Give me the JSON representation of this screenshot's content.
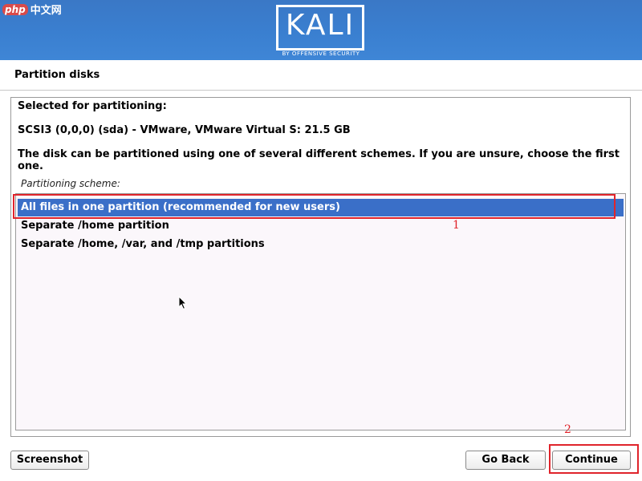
{
  "watermark": {
    "brand": "php",
    "site": "中文网"
  },
  "header": {
    "logo_text": "KALI",
    "logo_sub": "BY OFFENSIVE SECURITY",
    "banner_color": "#3a7fd0"
  },
  "page": {
    "title": "Partition disks"
  },
  "content": {
    "selected_heading": "Selected for partitioning:",
    "disk_description": "SCSI3 (0,0,0) (sda) - VMware, VMware Virtual S: 21.5 GB",
    "info_line1": "The disk can be partitioned using one of several different schemes. If you are unsure, choose the first",
    "info_line2": "one.",
    "scheme_label": "Partitioning scheme:"
  },
  "schemes": {
    "items": [
      {
        "label": "All files in one partition (recommended for new users)",
        "selected": true
      },
      {
        "label": "Separate /home partition",
        "selected": false
      },
      {
        "label": "Separate /home, /var, and /tmp partitions",
        "selected": false
      }
    ],
    "selected_color": "#3a6fc8"
  },
  "annotations": {
    "first": "1",
    "second": "2",
    "color": "#e0242b"
  },
  "buttons": {
    "screenshot": "Screenshot",
    "go_back": "Go Back",
    "continue": "Continue"
  }
}
